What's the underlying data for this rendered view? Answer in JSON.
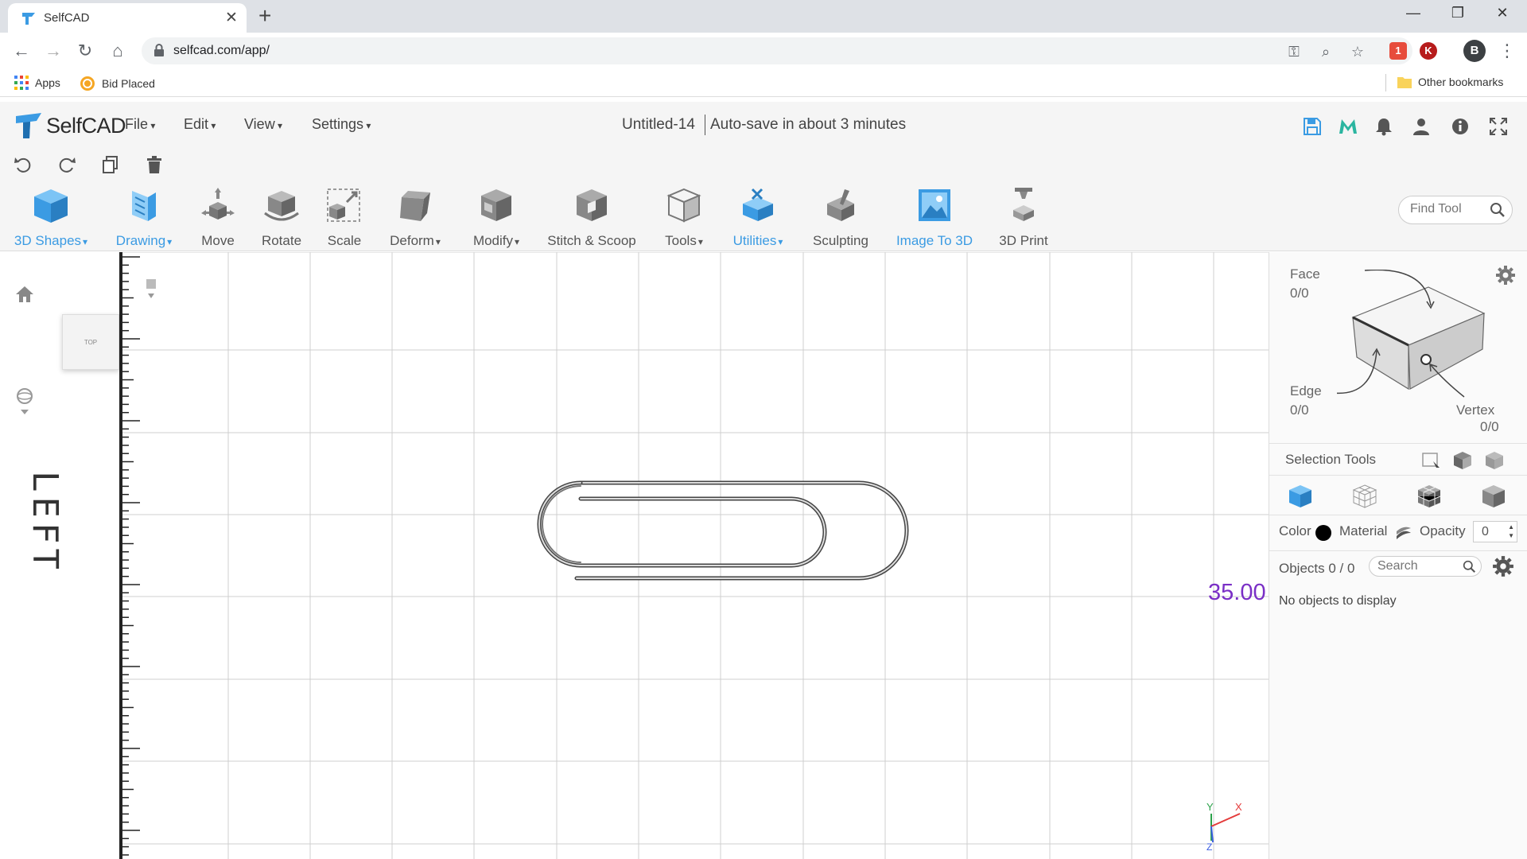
{
  "browser": {
    "tab_title": "SelfCAD",
    "url": "selfcad.com/app/",
    "profile_initial": "B",
    "ext_initial": "K",
    "ext_badge": "1",
    "bookmarks": {
      "apps": "Apps",
      "bid_placed": "Bid Placed",
      "other": "Other bookmarks"
    }
  },
  "app": {
    "logo_text": "SelfCAD",
    "menus": {
      "file": "File",
      "edit": "Edit",
      "view": "View",
      "settings": "Settings"
    },
    "document_title": "Untitled-14",
    "autosave": "Auto-save in about 3 minutes",
    "brand_color": "#3b9be3"
  },
  "tools": {
    "shapes": "3D Shapes",
    "drawing": "Drawing",
    "move": "Move",
    "rotate": "Rotate",
    "scale": "Scale",
    "deform": "Deform",
    "modify": "Modify",
    "stitch": "Stitch & Scoop",
    "tools": "Tools",
    "utilities": "Utilities",
    "sculpting": "Sculpting",
    "image_to_3d": "Image To 3D",
    "print": "3D Print",
    "find_placeholder": "Find Tool"
  },
  "viewport": {
    "cube_face": "TOP",
    "view_label": "LEFT",
    "dimension": "35.00",
    "axis_y": "Y",
    "axis_x": "X",
    "axis_z": "Z"
  },
  "panel": {
    "face_label": "Face",
    "face_count": "0/0",
    "edge_label": "Edge",
    "edge_count": "0/0",
    "vertex_label": "Vertex",
    "vertex_count": "0/0",
    "selection_tools": "Selection Tools",
    "color_label": "Color",
    "material_label": "Material",
    "opacity_label": "Opacity",
    "opacity_value": "0",
    "objects_label": "Objects 0 / 0",
    "search_placeholder": "Search",
    "empty_message": "No objects to display"
  }
}
